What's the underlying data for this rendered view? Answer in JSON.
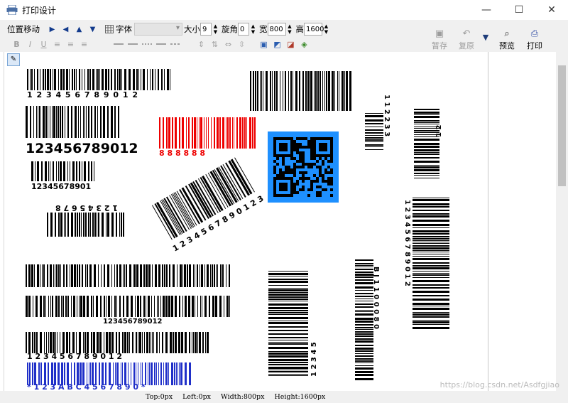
{
  "window": {
    "title": "打印设计",
    "minimize": "—",
    "maximize": "☐",
    "close": "✕"
  },
  "toolbar": {
    "move_label": "位置移动",
    "font_label": "字体",
    "size_label": "大小",
    "size_value": "9",
    "rotate_label": "旋角",
    "rotate_value": "0",
    "width_label": "宽",
    "width_value": "800",
    "height_label": "高",
    "height_value": "1600",
    "pause_label": "暂存",
    "restore_label": "复原",
    "preview_label": "预览",
    "print_label": "打印"
  },
  "status": {
    "top": "Top:0px",
    "left": "Left:0px",
    "width": "Width:800px",
    "height": "Height:1600px"
  },
  "barcodes": {
    "b1": "1 2 3 4 5 6 7 8 9 0 1 2",
    "b2": "123456789012",
    "b3": "8 8 8 8 8 8",
    "b4": "12345678901",
    "b5": "1 2 3 4 5 6 7 8",
    "b6": "1 2 3 4 5 6 7 8 9 0 1 2 3",
    "b7": "1 1 2 2 3 3",
    "b8": "1 2",
    "b9": "1 2 3 4 5 6 7 8 9 0 1 2",
    "b10": "123456789012",
    "b11": "1 2 3 4 5 6 7 8 9 0 1 2",
    "b12": "* 1 2 3 A B C 4 5 6 7 8 9 0 *",
    "b13": "1 2 3 4 5",
    "b14": "B J 1 1 0 0 0 8 0"
  },
  "watermark": "https://blog.csdn.net/Asdfgjiao"
}
